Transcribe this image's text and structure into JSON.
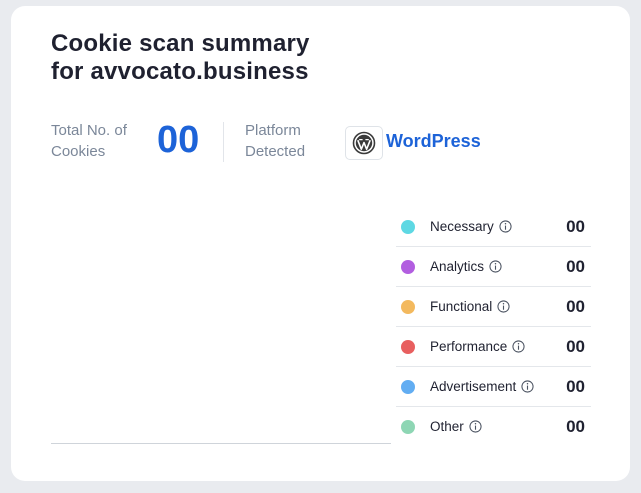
{
  "title": {
    "line1": "Cookie scan summary",
    "line2": "for avvocato.business"
  },
  "stats": {
    "total_label_line1": "Total No. of",
    "total_label_line2": "Cookies",
    "total_count": "00",
    "platform_label_line1": "Platform",
    "platform_label_line2": "Detected",
    "platform_name": "WordPress",
    "platform_icon": "wordpress-logo-icon"
  },
  "categories": [
    {
      "label": "Necessary",
      "count": "00",
      "color": "#5ed8e3"
    },
    {
      "label": "Analytics",
      "count": "00",
      "color": "#b25ee0"
    },
    {
      "label": "Functional",
      "count": "00",
      "color": "#f3b95e"
    },
    {
      "label": "Performance",
      "count": "00",
      "color": "#e85f5f"
    },
    {
      "label": "Advertisement",
      "count": "00",
      "color": "#62adf2"
    },
    {
      "label": "Other",
      "count": "00",
      "color": "#8ed6b4"
    }
  ],
  "colors": {
    "accent": "#1d63d8",
    "text": "#1f2130",
    "muted": "#7b8799"
  }
}
